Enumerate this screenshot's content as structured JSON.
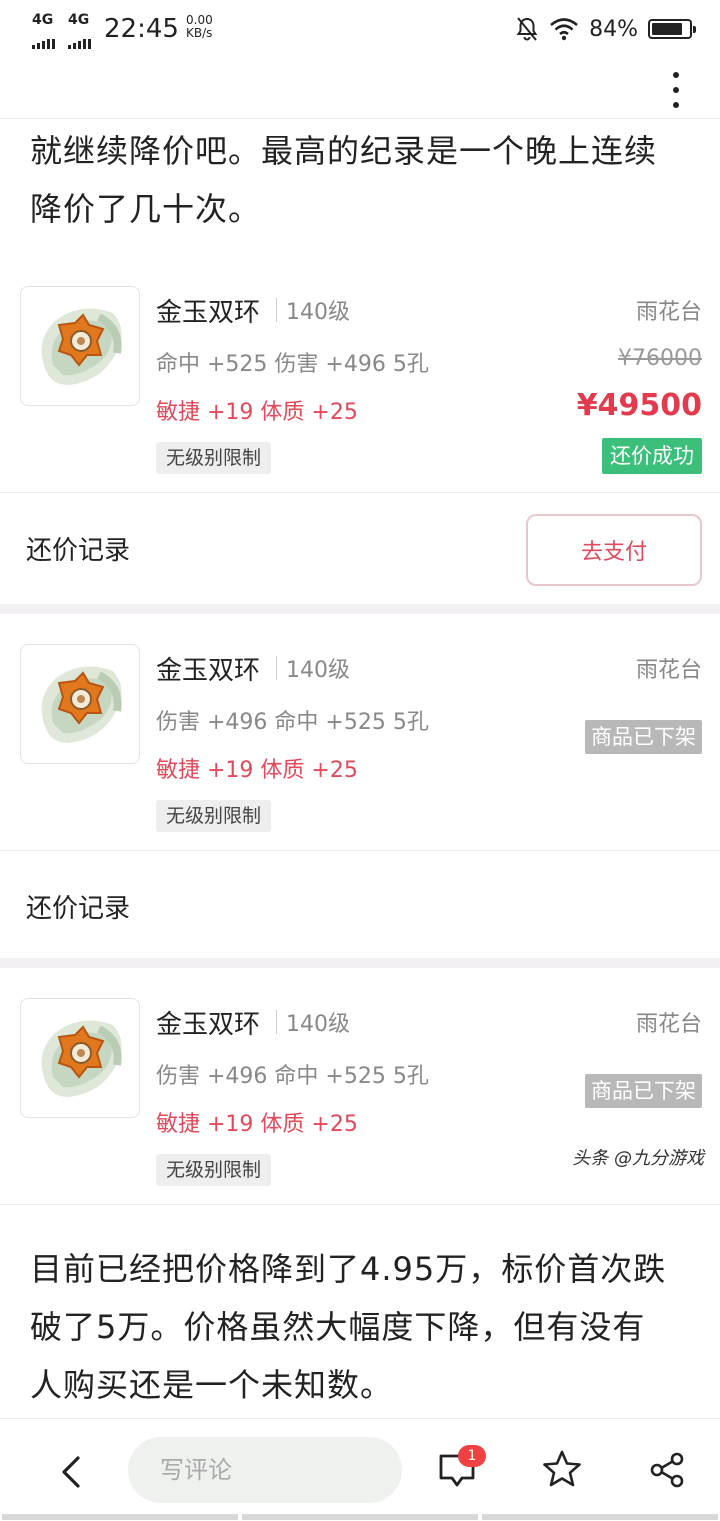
{
  "status_bar": {
    "network1": "4G",
    "network2": "4G",
    "time": "22:45",
    "speed_value": "0.00",
    "speed_unit": "KB/s",
    "battery_pct": "84%",
    "battery_level": 0.84
  },
  "article": {
    "para_top_line1": "就继续降价吧。最高的纪录是一个晚上连续",
    "para_top_line2": "降价了几十次。",
    "para_bottom_line1": "目前已经把价格降到了4.95万，标价首次跌",
    "para_bottom_line2": "破了5万。价格虽然大幅度下降，但有没有",
    "para_bottom_line3": "人购买还是一个未知数。"
  },
  "items": [
    {
      "name": "金玉双环",
      "level": "140级",
      "stats": "命中 +525 伤害 +496  5孔",
      "bonus": "敏捷 +19 体质 +25",
      "tag": "无级别限制",
      "server": "雨花台",
      "original_price": "¥76000",
      "price": "¥49500",
      "status": "还价成功"
    },
    {
      "name": "金玉双环",
      "level": "140级",
      "stats": "伤害 +496 命中 +525  5孔",
      "bonus": "敏捷 +19 体质 +25",
      "tag": "无级别限制",
      "server": "雨花台",
      "status": "商品已下架"
    },
    {
      "name": "金玉双环",
      "level": "140级",
      "stats": "伤害 +496 命中 +525  5孔",
      "bonus": "敏捷 +19 体质 +25",
      "tag": "无级别限制",
      "server": "雨花台",
      "status": "商品已下架"
    }
  ],
  "bargain_record_label": "还价记录",
  "pay_button": "去支付",
  "watermark": "头条 @九分游戏",
  "bottom_bar": {
    "comment_placeholder": "写评论",
    "comment_count": "1"
  },
  "colors": {
    "price_red": "#e23b4e",
    "success_green": "#3cbf7a",
    "offshelf_gray": "#b8b8b8"
  }
}
